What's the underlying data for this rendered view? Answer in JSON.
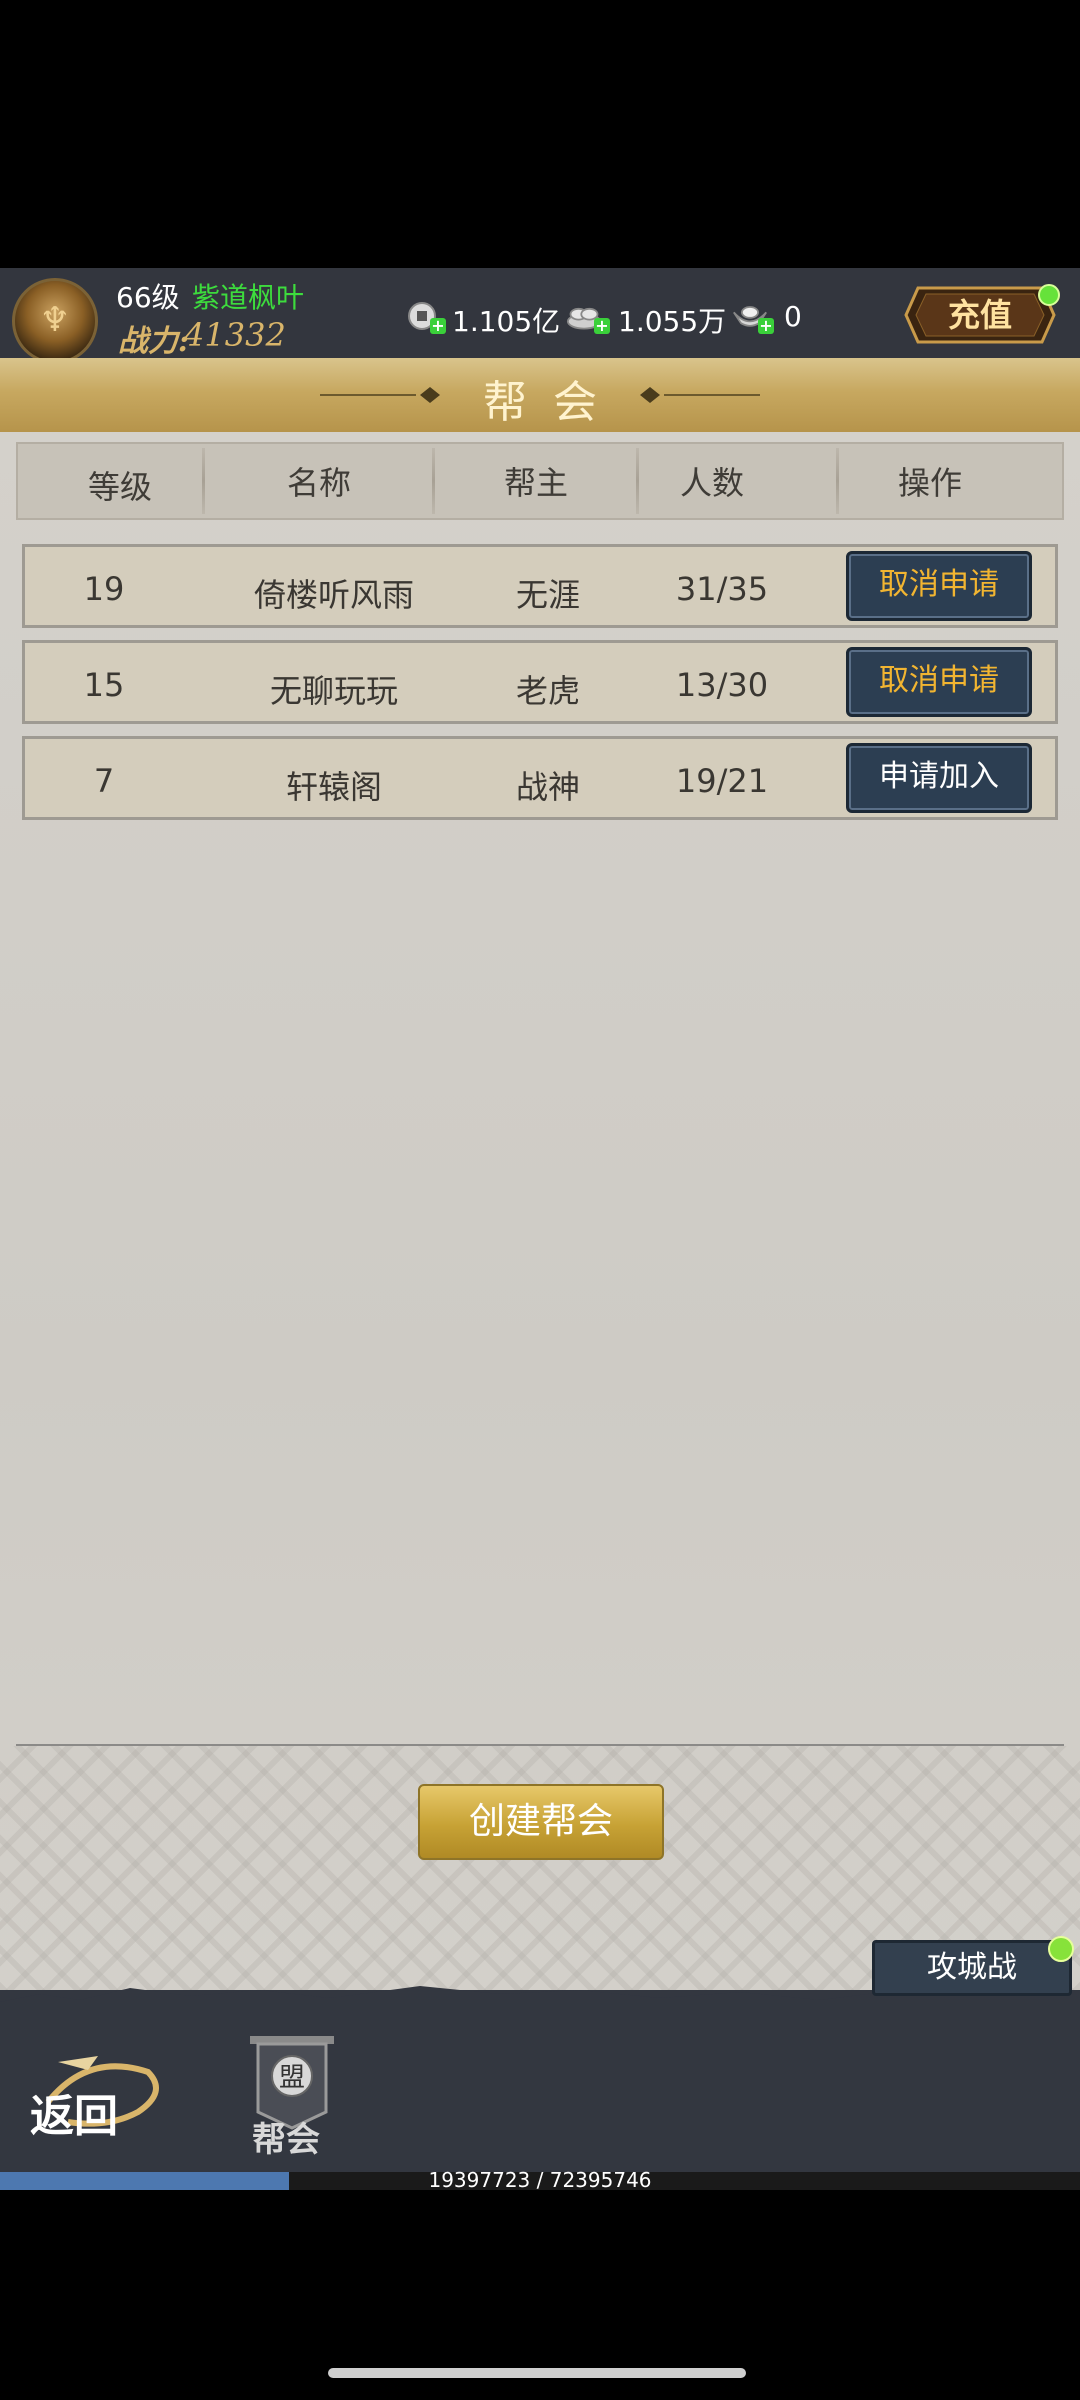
{
  "player": {
    "level": "66级",
    "name": "紫道枫叶",
    "power_label": "战力:",
    "power_value": "41332"
  },
  "resources": [
    {
      "icon": "coin-icon",
      "value": "1.105亿"
    },
    {
      "icon": "silver-pile-icon",
      "value": "1.055万"
    },
    {
      "icon": "ingot-icon",
      "value": "0"
    }
  ],
  "recharge_label": "充值",
  "title": "帮会",
  "table": {
    "headers": [
      "等级",
      "名称",
      "帮主",
      "人数",
      "操作"
    ],
    "rows": [
      {
        "level": "19",
        "name": "倚楼听风雨",
        "leader": "无涯",
        "members": "31/35",
        "action": "取消申请",
        "action_type": "cancel"
      },
      {
        "level": "15",
        "name": "无聊玩玩",
        "leader": "老虎",
        "members": "13/30",
        "action": "取消申请",
        "action_type": "cancel"
      },
      {
        "level": "7",
        "name": "轩辕阁",
        "leader": "战神",
        "members": "19/21",
        "action": "申请加入",
        "action_type": "join"
      }
    ]
  },
  "create_button": "创建帮会",
  "siege_button": "攻城战",
  "bottom_nav": {
    "back_label": "返回",
    "guild_label": "帮会",
    "guild_emblem": "盟"
  },
  "progress": {
    "text": "19397723 / 72395746",
    "fraction": 0.268
  },
  "colors": {
    "accent_gold": "#c7a860",
    "cancel_text": "#f2b531",
    "name_green": "#3ddc3d",
    "button_bg": "#2c3e52"
  }
}
